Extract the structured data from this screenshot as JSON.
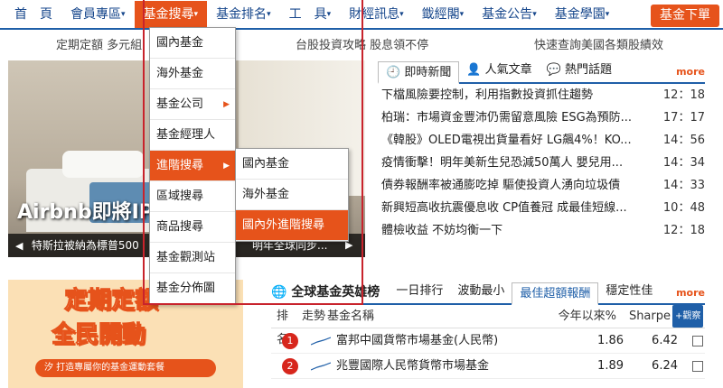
{
  "nav": {
    "items": [
      "首　頁",
      "會員專區",
      "基金搜尋",
      "基金排名",
      "工　具",
      "財經訊息",
      "韱經閣",
      "基金公告",
      "基金學園",
      "基金下單"
    ]
  },
  "subbar": {
    "left": "定期定額 多元組",
    "middle": "台股投資攻略 股息領不停",
    "right": "快速查詢美國各類股績效"
  },
  "carousel": {
    "title": "Airbnb即將IPO",
    "caption": "特斯拉被納為標普500",
    "caption_right": "明年全球同步..."
  },
  "news": {
    "tabs": [
      "即時新聞",
      "人氣文章",
      "熱門話題"
    ],
    "more": "more",
    "items": [
      {
        "title": "下檔風險要控制，利用指數投資抓住趨勢",
        "time": "12：18"
      },
      {
        "title": "柏瑞：市場資金豐沛仍需留意風險 ESG為預防...",
        "time": "17：17"
      },
      {
        "title": "《韓股》OLED電視出貨量看好 LG飆4%！KO...",
        "time": "14：56"
      },
      {
        "title": "疫情衝擊！明年美新生兒恐減50萬人 嬰兒用...",
        "time": "14：34"
      },
      {
        "title": "債券報酬率被通膨吃掉 驅使投資人湧向垃圾債",
        "time": "14：33"
      },
      {
        "title": "新興短高收抗震優息收 CP值養冠 成最佳短線...",
        "time": "10：48"
      },
      {
        "title": "體檢收益 不妨均衡一下",
        "time": "12：18"
      }
    ]
  },
  "promo": {
    "line1": "定期定額",
    "line2": "全民開動",
    "bar": "汐 打造專屬你的基金運動套餐"
  },
  "hero": {
    "title": "全球基金英雄榜",
    "tabs": [
      "一日排行",
      "波動最小",
      "最佳超額報酬",
      "穩定性佳"
    ],
    "more": "more",
    "head": {
      "rank": "排名",
      "trend": "走勢",
      "name": "基金名稱",
      "ytd": "今年以來%",
      "sharpe": "Sharpe",
      "watch": "+觀察"
    },
    "rows": [
      {
        "rank": "1",
        "name": "富邦中國貨幣市場基金(人民幣)",
        "ytd": "1.86",
        "sharpe": "6.42"
      },
      {
        "rank": "2",
        "name": "兆豐國際人民幣貨幣市場基金",
        "ytd": "1.89",
        "sharpe": "6.24"
      }
    ]
  },
  "menu_search": {
    "items": [
      "國內基金",
      "海外基金",
      "基金公司",
      "基金經理人",
      "進階搜尋",
      "區域搜尋",
      "商品搜尋",
      "基金觀測站",
      "基金分佈圖"
    ]
  },
  "menu_advanced": {
    "items": [
      "國內基金",
      "海外基金",
      "國內外進階搜尋"
    ]
  },
  "colors": {
    "accent": "#e6531b",
    "nav_text": "#17478c",
    "border_blue": "#1f5fa8",
    "highlight_red": "#c8232c"
  }
}
